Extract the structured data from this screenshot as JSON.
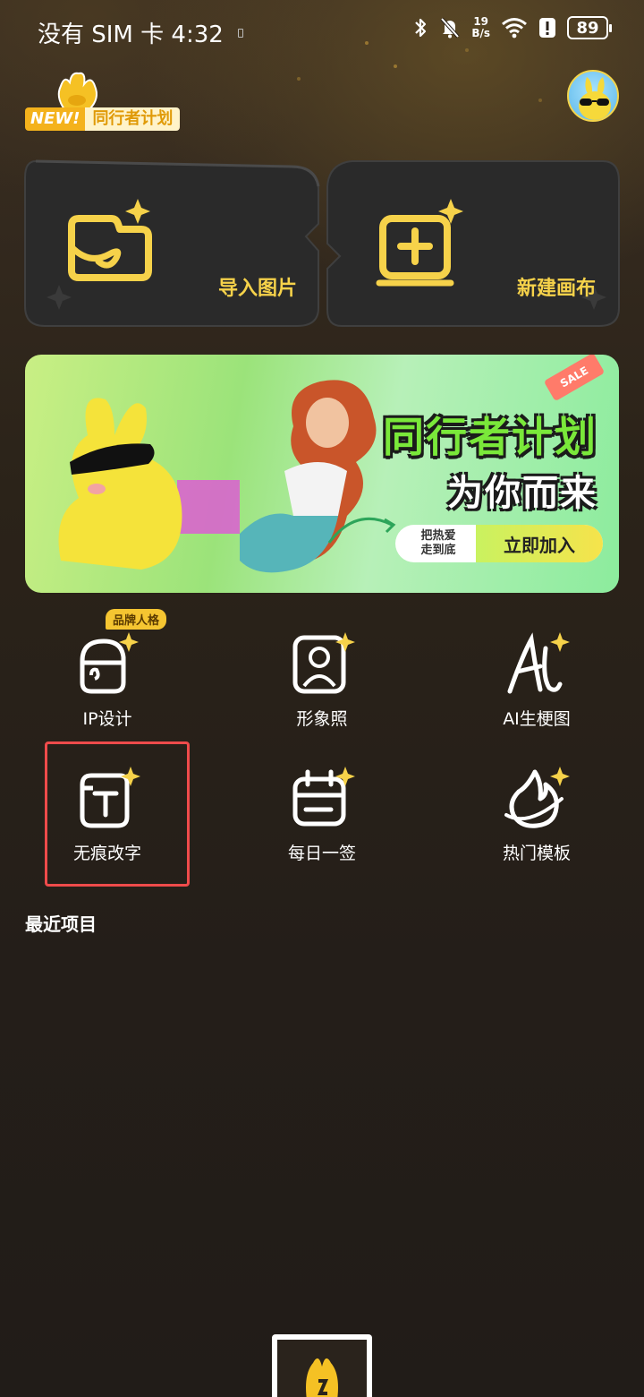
{
  "status_bar": {
    "carrier_time": "没有 SIM 卡 4:32",
    "network_speed_value": "19",
    "network_speed_unit": "B/s",
    "battery": "89"
  },
  "header": {
    "badge_new": "NEW!",
    "badge_plan": "同行者计划"
  },
  "cards": {
    "import": "导入图片",
    "new_canvas": "新建画布"
  },
  "banner": {
    "title": "同行者计划",
    "subtitle": "为你而来",
    "cta_small_line1": "把热爱",
    "cta_small_line2": "走到底",
    "cta_button": "立即加入",
    "sale": "SALE"
  },
  "tools": [
    {
      "label": "IP设计",
      "badge": "品牌人格",
      "icon": "ip-design-icon"
    },
    {
      "label": "形象照",
      "icon": "portrait-icon"
    },
    {
      "label": "AI生梗图",
      "icon": "ai-meme-icon"
    },
    {
      "label": "无痕改字",
      "icon": "text-edit-icon"
    },
    {
      "label": "每日一签",
      "icon": "daily-sign-icon"
    },
    {
      "label": "热门模板",
      "icon": "hot-template-icon"
    }
  ],
  "recent": {
    "title": "最近项目"
  },
  "colors": {
    "accent": "#f6d24a",
    "highlight": "#ef4b4b",
    "background": "#2a221b"
  }
}
